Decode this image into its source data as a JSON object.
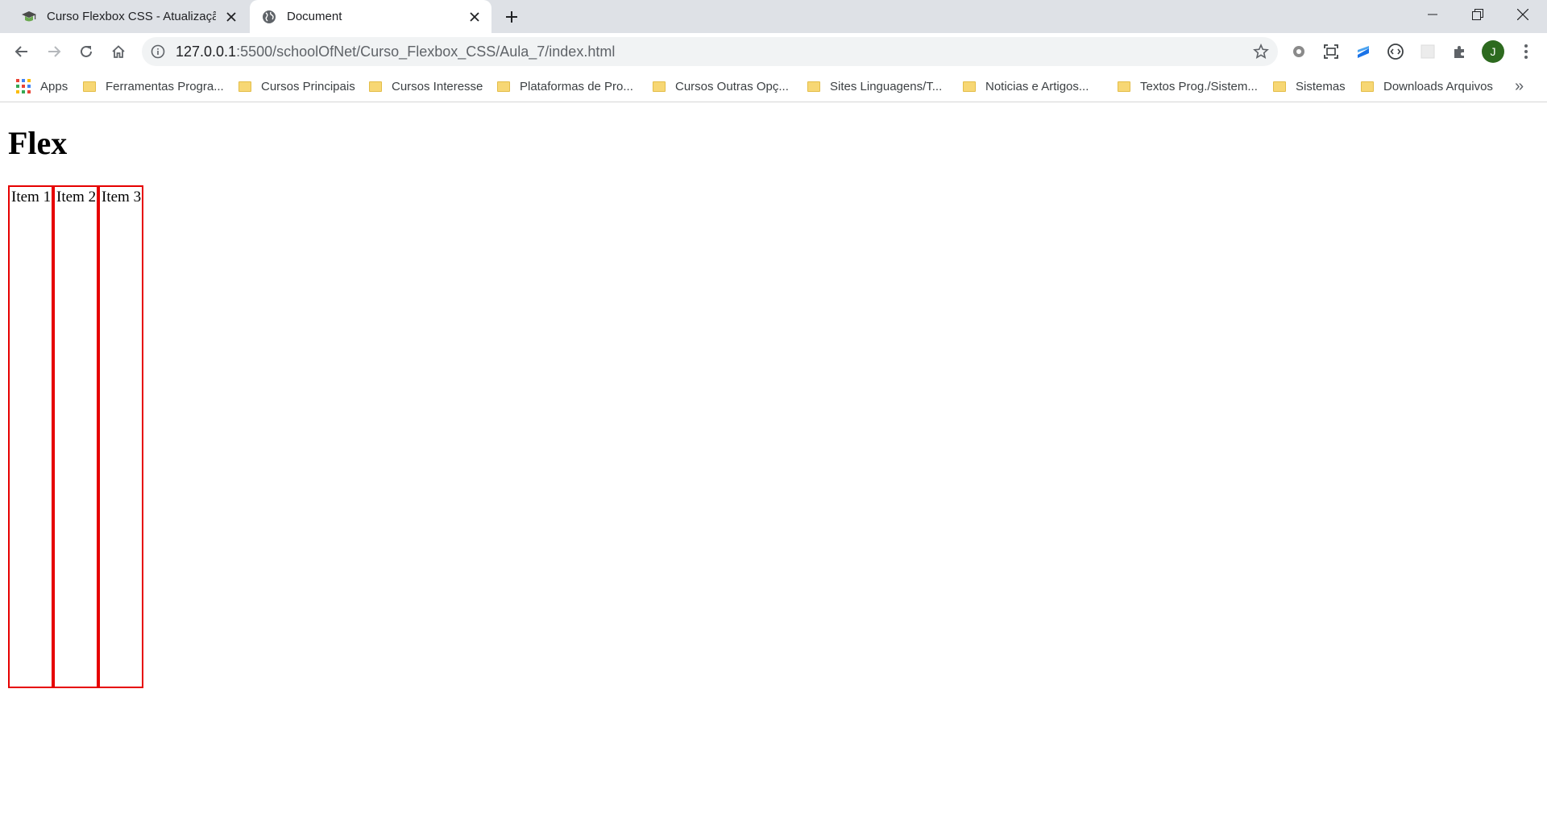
{
  "browser": {
    "tabs": [
      {
        "title": "Curso Flexbox CSS - Atualização",
        "active": false,
        "favicon": "graduation-cap-icon"
      },
      {
        "title": "Document",
        "active": true,
        "favicon": "globe-icon"
      }
    ],
    "address": {
      "host": "127.0.0.1",
      "path": ":5500/schoolOfNet/Curso_Flexbox_CSS/Aula_7/index.html"
    },
    "profile_initial": "J",
    "bookmarks": [
      {
        "label": "Apps",
        "type": "apps"
      },
      {
        "label": "Ferramentas Progra...",
        "type": "folder"
      },
      {
        "label": "Cursos Principais",
        "type": "folder"
      },
      {
        "label": "Cursos Interesse",
        "type": "folder"
      },
      {
        "label": "Plataformas de Pro...",
        "type": "folder"
      },
      {
        "label": "Cursos Outras Opç...",
        "type": "folder"
      },
      {
        "label": "Sites Linguagens/T...",
        "type": "folder"
      },
      {
        "label": "Noticias e Artigos...",
        "type": "folder"
      },
      {
        "label": "Textos Prog./Sistem...",
        "type": "folder"
      },
      {
        "label": "Sistemas",
        "type": "folder"
      },
      {
        "label": "Downloads Arquivos",
        "type": "folder"
      }
    ],
    "overflow": "»"
  },
  "page": {
    "heading": "Flex",
    "items": [
      "Item 1",
      "Item 2",
      "Item 3"
    ],
    "item_border_color": "#e60000"
  }
}
